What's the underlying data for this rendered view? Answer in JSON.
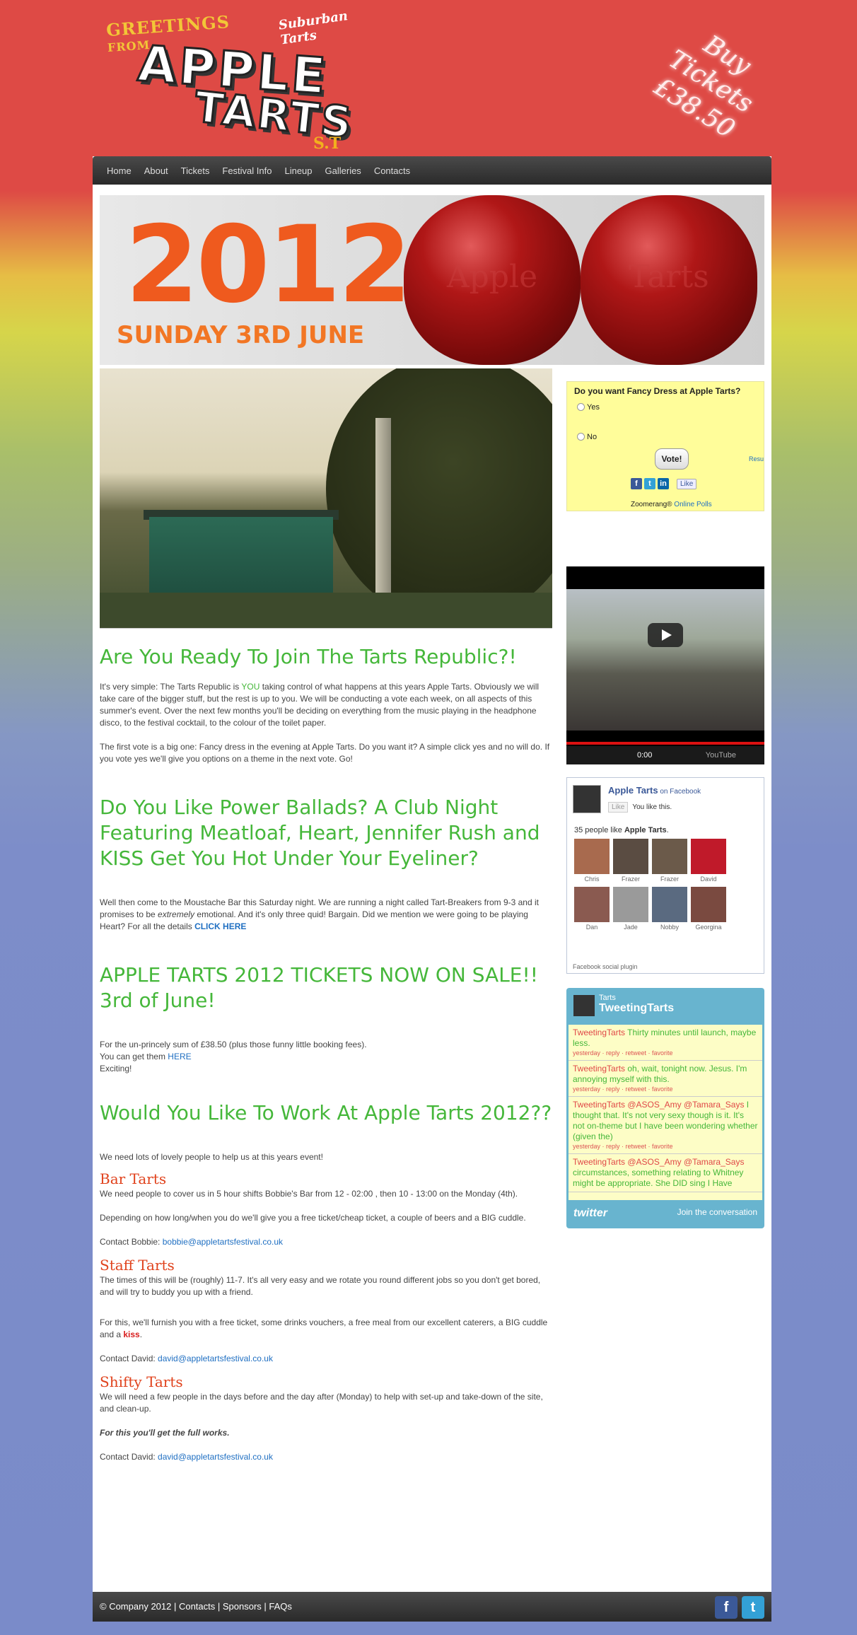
{
  "header": {
    "greetings": "GREETINGS",
    "from": "FROM",
    "suburban": "Suburban Tarts",
    "apple": "APPLE",
    "tarts": "TARTS",
    "st": "S.T",
    "buy_line1": "Buy Tickets",
    "buy_line2": "£38.50"
  },
  "nav": [
    "Home",
    "About",
    "Tickets",
    "Festival Info",
    "Lineup",
    "Galleries",
    "Contacts"
  ],
  "banner": {
    "year": "2012",
    "date": "SUNDAY 3RD JUNE",
    "apple_left": "Apple",
    "apple_right": "Tarts"
  },
  "main": {
    "h1": "Are You Ready To Join The Tarts Republic?!",
    "p1_before": "It's very simple: The Tarts Republic is ",
    "p1_you": "YOU",
    "p1_after": " taking control of what happens at this years Apple Tarts. Obviously we will take care of the bigger stuff, but the rest is up to you.  We will be conducting a vote each week, on all aspects of this summer's event.  Over the next few months you'll be deciding on everything from the music playing in the headphone disco, to the festival cocktail, to the colour of the toilet paper.",
    "p2": "The first vote is a big one: Fancy dress in the evening at Apple Tarts.   Do you want it? A simple click yes and no will do. If you vote yes we'll give you options on a theme in the next vote. Go!",
    "h2": "Do You Like Power Ballads?  A Club Night Featuring Meatloaf, Heart, Jennifer Rush and KISS Get You Hot Under Your Eyeliner?",
    "p3_before": "Well then come to the Moustache Bar this Saturday night.  We are running a night called Tart-Breakers from 9-3 and it promises to be ",
    "p3_em": "extremely",
    "p3_after": " emotional.  And it's only three quid!  Bargain.  Did we mention we were going to be playing Heart? For all the details ",
    "p3_link": "CLICK HERE",
    "h3": "APPLE TARTS 2012 TICKETS NOW ON SALE!! 3rd of June!",
    "p4_line1": "For the un-princely sum of £38.50 (plus those funny little booking fees).",
    "p4_line2_before": "You can get them ",
    "p4_line2_link": "HERE",
    "p4_line3": "Exciting!",
    "h4": "Would You Like To Work At Apple Tarts 2012??",
    "p5": "We need lots of lovely people to help us at this years event!",
    "bar_head": "Bar Tarts",
    "bar_p1": "We need people to cover us in 5 hour shifts Bobbie's Bar from 12 - 02:00 , then 10 - 13:00 on the Monday (4th).",
    "bar_p2": "Depending on how long/when you do we'll give you a free ticket/cheap ticket, a couple of beers and a BIG cuddle.",
    "bar_contact_label": "Contact Bobbie:  ",
    "bar_contact_email": "bobbie@appletartsfestival.co.uk",
    "staff_head": "Staff Tarts",
    "staff_p1": "The times of this will be (roughly) 11-7.     It's all very easy and we rotate you round different jobs so you don't get bored, and will try to buddy you up with a friend.",
    "staff_p2_before": "For this, we'll furnish you with a free ticket, some drinks  vouchers, a free meal from  our excellent caterers, a BIG cuddle and a ",
    "staff_p2_kiss": "kiss",
    "staff_p2_after": ".",
    "staff_contact_label": "Contact David: ",
    "staff_contact_email": "david@appletartsfestival.co.uk",
    "shifty_head": "Shifty Tarts",
    "shifty_p1": "We will need a few people in the days before and the day after (Monday) to help with set-up and take-down of the site, and clean-up.",
    "shifty_p2": "For this you'll get the full works.",
    "shifty_contact_label": "Contact David:    ",
    "shifty_contact_email": "david@appletartsfestival.co.uk"
  },
  "poll": {
    "question": "Do you want Fancy Dress at Apple Tarts?",
    "options": [
      "Yes",
      "No"
    ],
    "vote": "Vote!",
    "results": "Resu",
    "like": "Like",
    "zoom_prefix": "Zoomerang® ",
    "zoom_link": "Online Polls"
  },
  "video": {
    "time": "0:00",
    "brand": "YouTube"
  },
  "facebook": {
    "name": "Apple Tarts",
    "on": " on Facebook",
    "like_btn": "Like",
    "you_like": "You like this.",
    "count_prefix": "35 people like ",
    "count_name": "Apple Tarts",
    "count_suffix": ".",
    "people": [
      "Chris",
      "Frazer",
      "Frazer",
      "David",
      "Dan",
      "Jade",
      "Nobby",
      "Georgina"
    ],
    "plugin": "Facebook social plugin"
  },
  "twitter": {
    "small": "Tarts",
    "name": "TweetingTarts",
    "tweets": [
      {
        "user": "TweetingTarts",
        "text": " Thirty minutes until launch, maybe less.",
        "meta": "yesterday · reply · retweet · favorite"
      },
      {
        "user": "TweetingTarts",
        "text": " oh, wait, tonight now. Jesus. I'm annoying myself with this.",
        "meta": "yesterday · reply · retweet · favorite"
      },
      {
        "user": "TweetingTarts @ASOS_Amy @Tamara_Says",
        "text": " I thought that. It's not very sexy though is it. It's not on-theme but I have been wondering whether (given the)",
        "meta": "yesterday · reply · retweet · favorite"
      },
      {
        "user": "TweetingTarts @ASOS_Amy @Tamara_Says",
        "text": " circumstances, something relating to Whitney might be appropriate. She DID sing I Have",
        "meta": ""
      }
    ],
    "logo": "twitter",
    "join": "Join the conversation"
  },
  "footer": {
    "text": "© Company 2012 | Contacts | Sponsors | FAQs",
    "fb": "f",
    "tw": "t"
  },
  "colors": {
    "accent_green": "#45b73a",
    "accent_red": "#e0421c",
    "link_blue": "#1f6fc2"
  }
}
